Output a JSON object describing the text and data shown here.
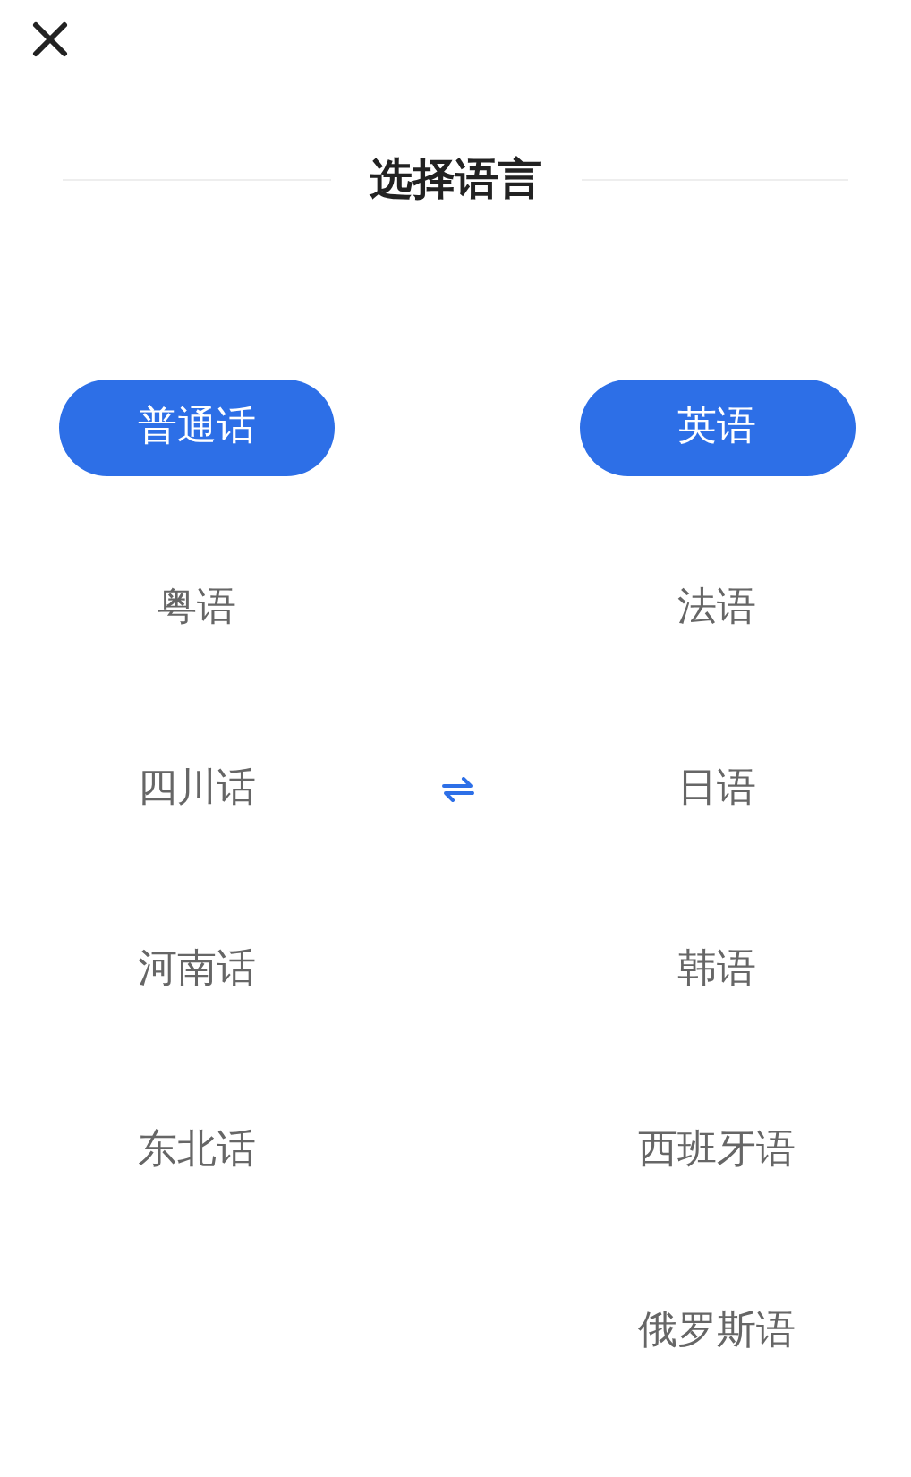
{
  "title": "选择语言",
  "source_languages": [
    {
      "label": "普通话",
      "selected": true
    },
    {
      "label": "粤语",
      "selected": false
    },
    {
      "label": "四川话",
      "selected": false
    },
    {
      "label": "河南话",
      "selected": false
    },
    {
      "label": "东北话",
      "selected": false
    }
  ],
  "target_languages": [
    {
      "label": "英语",
      "selected": true
    },
    {
      "label": "法语",
      "selected": false
    },
    {
      "label": "日语",
      "selected": false
    },
    {
      "label": "韩语",
      "selected": false
    },
    {
      "label": "西班牙语",
      "selected": false
    },
    {
      "label": "俄罗斯语",
      "selected": false
    }
  ]
}
